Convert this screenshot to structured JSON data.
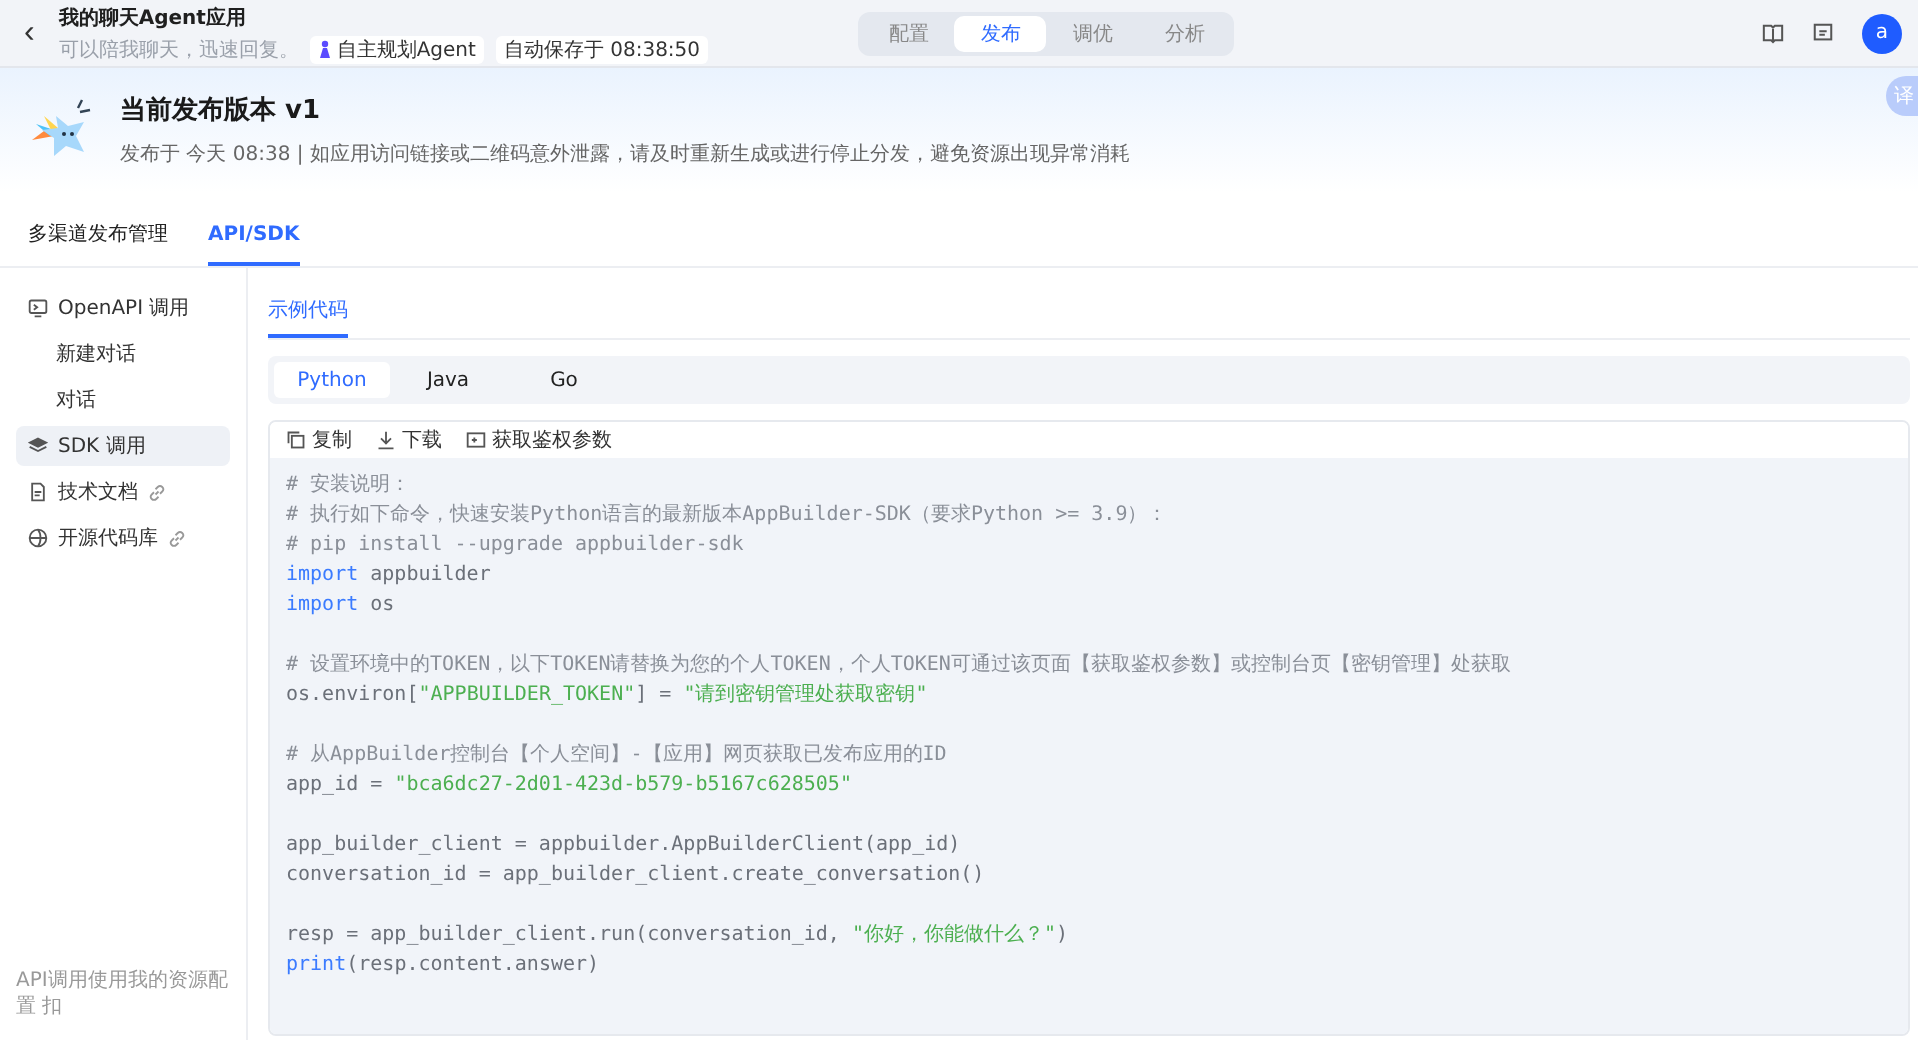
{
  "header": {
    "back": "‹",
    "title": "我的聊天Agent应用",
    "subtitle": "可以陪我聊天，迅速回复。",
    "agent_tag": "自主规划Agent",
    "autosave": "自动保存于 08:38:50",
    "avatar": "a",
    "translate_button": "译"
  },
  "mode_tabs": [
    {
      "label": "配置",
      "selected": false
    },
    {
      "label": "发布",
      "selected": true
    },
    {
      "label": "调优",
      "selected": false
    },
    {
      "label": "分析",
      "selected": false
    }
  ],
  "release": {
    "title": "当前发布版本 v1",
    "info": "发布于 今天 08:38 | 如应用访问链接或二维码意外泄露，请及时重新生成或进行停止分发，避免资源出现异常消耗"
  },
  "page_tabs": [
    {
      "label": "多渠道发布管理",
      "selected": false
    },
    {
      "label": "API/SDK",
      "selected": true
    }
  ],
  "sidebar": {
    "items": [
      {
        "label": "OpenAPI 调用",
        "link": false,
        "selected": false,
        "children": [
          {
            "label": "新建对话",
            "selected": false
          },
          {
            "label": "对话",
            "selected": false
          }
        ]
      },
      {
        "label": "SDK 调用",
        "link": false,
        "selected": true
      },
      {
        "label": "技术文档",
        "link": true,
        "selected": false
      },
      {
        "label": "开源代码库",
        "link": true,
        "selected": false
      }
    ],
    "footer": "API调用使用我的资源配置 扣"
  },
  "section_tab": {
    "label": "示例代码",
    "selected": true
  },
  "language_tabs": [
    {
      "label": "Python",
      "selected": true
    },
    {
      "label": "Java",
      "selected": false
    },
    {
      "label": "Go",
      "selected": false
    }
  ],
  "toolbar": [
    {
      "label": "复制"
    },
    {
      "label": "下载"
    },
    {
      "label": "获取鉴权参数"
    }
  ],
  "code_lines": [
    {
      "kind": "code",
      "tokens": [
        {
          "kind": "comment",
          "text": "# 安装说明："
        }
      ]
    },
    {
      "kind": "code",
      "tokens": [
        {
          "kind": "comment",
          "text": "# 执行如下命令，快速安装Python语言的最新版本AppBuilder-SDK（要求Python >= 3.9）："
        }
      ]
    },
    {
      "kind": "code",
      "tokens": [
        {
          "kind": "comment",
          "text": "# pip install --upgrade appbuilder-sdk"
        }
      ]
    },
    {
      "kind": "code",
      "tokens": [
        {
          "kind": "keyword",
          "text": "import"
        },
        {
          "kind": "plain",
          "text": " appbuilder"
        }
      ]
    },
    {
      "kind": "code",
      "tokens": [
        {
          "kind": "keyword",
          "text": "import"
        },
        {
          "kind": "plain",
          "text": " os"
        }
      ]
    },
    {
      "kind": "blank"
    },
    {
      "kind": "code",
      "tokens": [
        {
          "kind": "comment",
          "text": "# 设置环境中的TOKEN，以下TOKEN请替换为您的个人TOKEN，个人TOKEN可通过该页面【获取鉴权参数】或控制台页【密钥管理】处获取"
        }
      ]
    },
    {
      "kind": "code",
      "tokens": [
        {
          "kind": "plain",
          "text": "os.environ["
        },
        {
          "kind": "string",
          "text": "\"APPBUILDER_TOKEN\""
        },
        {
          "kind": "plain",
          "text": "] = "
        },
        {
          "kind": "string",
          "text": "\"请到密钥管理处获取密钥\""
        }
      ]
    },
    {
      "kind": "blank"
    },
    {
      "kind": "code",
      "tokens": [
        {
          "kind": "comment",
          "text": "# 从AppBuilder控制台【个人空间】-【应用】网页获取已发布应用的ID"
        }
      ]
    },
    {
      "kind": "code",
      "tokens": [
        {
          "kind": "plain",
          "text": "app_id = "
        },
        {
          "kind": "string",
          "text": "\"bca6dc27-2d01-423d-b579-b5167c628505\""
        }
      ]
    },
    {
      "kind": "blank"
    },
    {
      "kind": "code",
      "tokens": [
        {
          "kind": "plain",
          "text": "app_builder_client = appbuilder.AppBuilderClient(app_id)"
        }
      ]
    },
    {
      "kind": "code",
      "tokens": [
        {
          "kind": "plain",
          "text": "conversation_id = app_builder_client.create_conversation()"
        }
      ]
    },
    {
      "kind": "blank"
    },
    {
      "kind": "code",
      "tokens": [
        {
          "kind": "plain",
          "text": "resp = app_builder_client.run(conversation_id, "
        },
        {
          "kind": "string",
          "text": "\"你好，你能做什么？\""
        },
        {
          "kind": "plain",
          "text": ")"
        }
      ]
    },
    {
      "kind": "code",
      "tokens": [
        {
          "kind": "keyword",
          "text": "print"
        },
        {
          "kind": "plain",
          "text": "(resp.content.answer)"
        }
      ]
    }
  ]
}
